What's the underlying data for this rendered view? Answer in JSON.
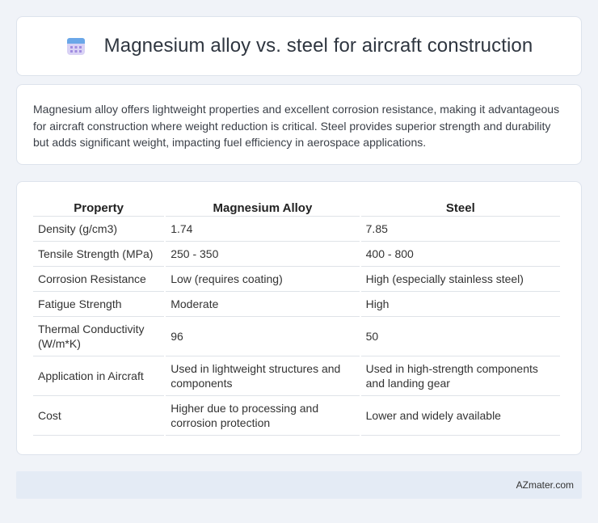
{
  "header": {
    "title": "Magnesium alloy vs. steel for aircraft construction",
    "icon": "calendar-icon"
  },
  "intro": {
    "text": "Magnesium alloy offers lightweight properties and excellent corrosion resistance, making it advantageous for aircraft construction where weight reduction is critical. Steel provides superior strength and durability but adds significant weight, impacting fuel efficiency in aerospace applications."
  },
  "table": {
    "headers": [
      "Property",
      "Magnesium Alloy",
      "Steel"
    ],
    "rows": [
      [
        "Density (g/cm3)",
        "1.74",
        "7.85"
      ],
      [
        "Tensile Strength (MPa)",
        "250 - 350",
        "400 - 800"
      ],
      [
        "Corrosion Resistance",
        "Low (requires coating)",
        "High (especially stainless steel)"
      ],
      [
        "Fatigue Strength",
        "Moderate",
        "High"
      ],
      [
        "Thermal Conductivity (W/m*K)",
        "96",
        "50"
      ],
      [
        "Application in Aircraft",
        "Used in lightweight structures and components",
        "Used in high-strength components and landing gear"
      ],
      [
        "Cost",
        "Higher due to processing and corrosion protection",
        "Lower and widely available"
      ]
    ]
  },
  "footer": {
    "text": "AZmater.com"
  },
  "colors": {
    "background": "#f0f3f8",
    "card": "#ffffff",
    "footer": "#e4ebf5",
    "icon_accent": "#8a6fd8"
  }
}
